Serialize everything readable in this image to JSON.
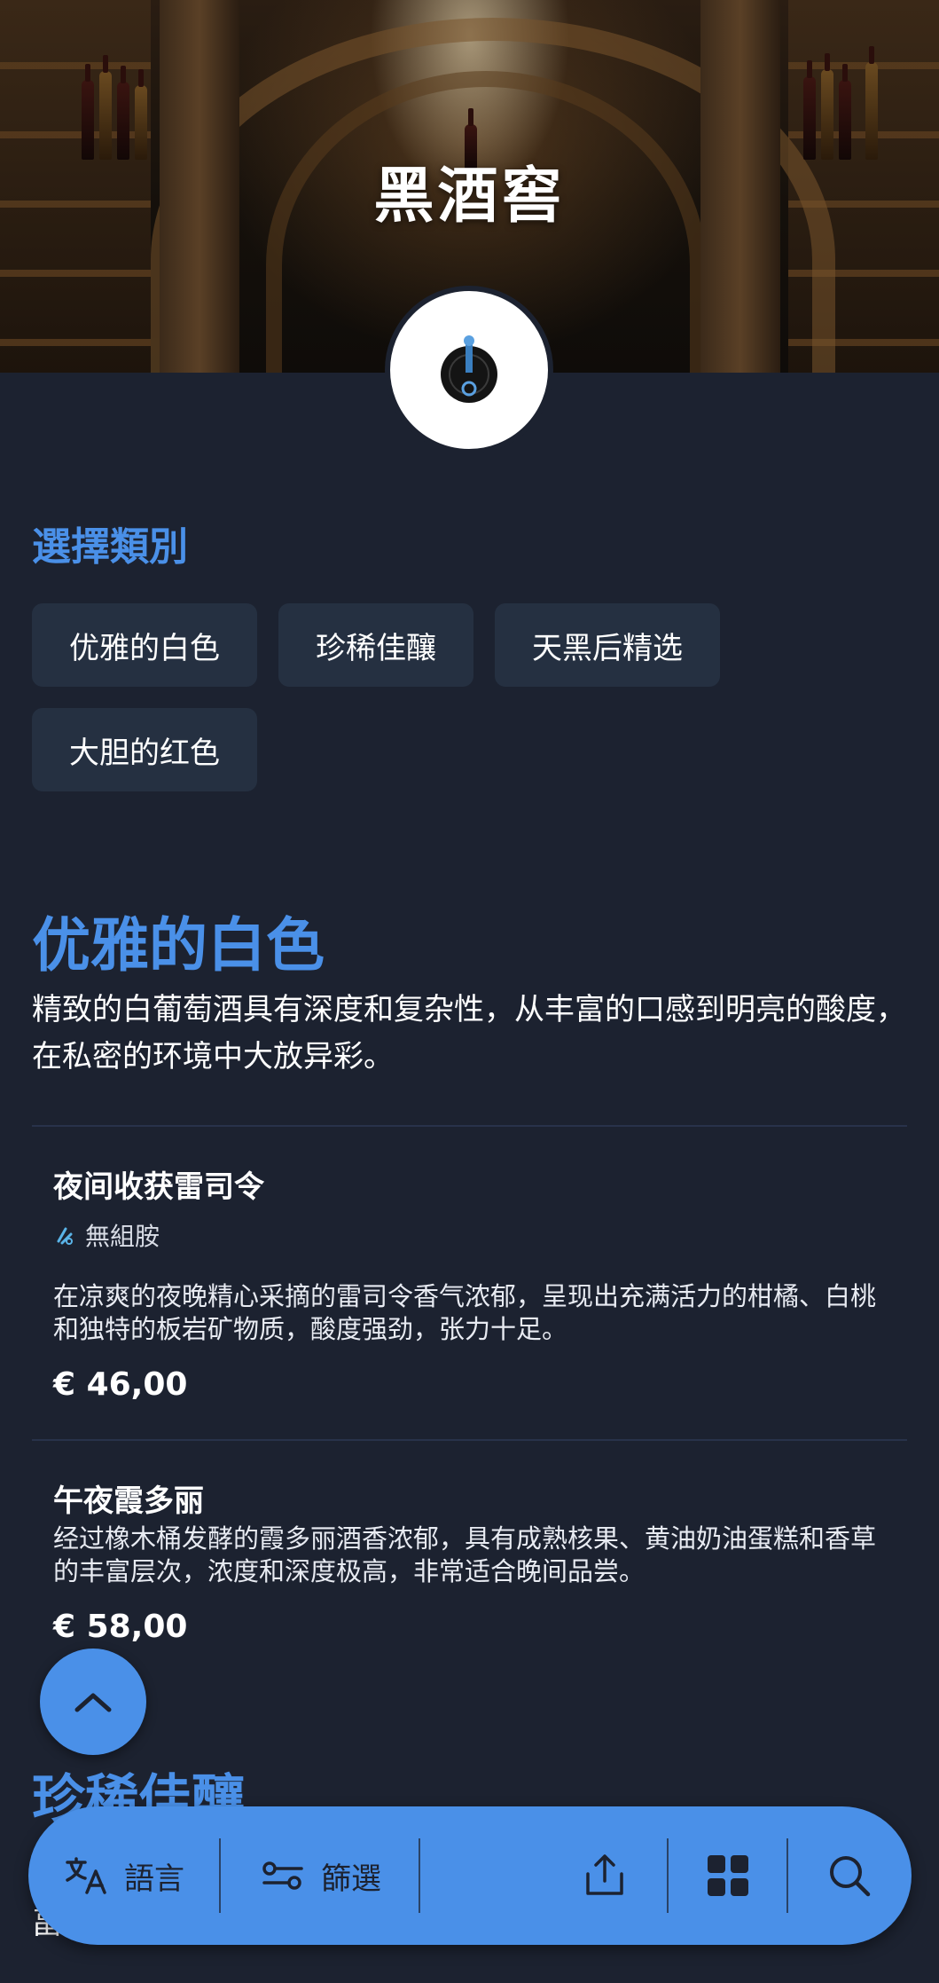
{
  "header": {
    "title": "黑酒窖"
  },
  "categories_section": {
    "label": "選擇類別",
    "chips": [
      "优雅的白色",
      "珍稀佳釀",
      "天黑后精选",
      "大胆的红色"
    ]
  },
  "category": {
    "title": "优雅的白色",
    "description": "精致的白葡萄酒具有深度和复杂性，从丰富的口感到明亮的酸度，在私密的环境中大放异彩。",
    "items": [
      {
        "name": "夜间收获雷司令",
        "allergen": "無組胺",
        "description": "在凉爽的夜晚精心采摘的雷司令香气浓郁，呈现出充满活力的柑橘、白桃和独特的板岩矿物质，酸度强劲，张力十足。",
        "price": "€ 46,00"
      },
      {
        "name": "午夜霞多丽",
        "description": "经过橡木桶发酵的霞多丽酒香浓郁，具有成熟核果、黄油奶油蛋糕和香草的丰富层次，浓度和深度极高，非常适合晚间品尝。",
        "price": "€ 58,00"
      }
    ]
  },
  "next_category": {
    "title": "珍稀佳釀",
    "cut_text": "畐"
  },
  "bottom_bar": {
    "language_label": "語言",
    "filter_label": "篩選"
  },
  "colors": {
    "accent": "#4a90e8",
    "background": "#1c2230",
    "chip": "#253041"
  }
}
